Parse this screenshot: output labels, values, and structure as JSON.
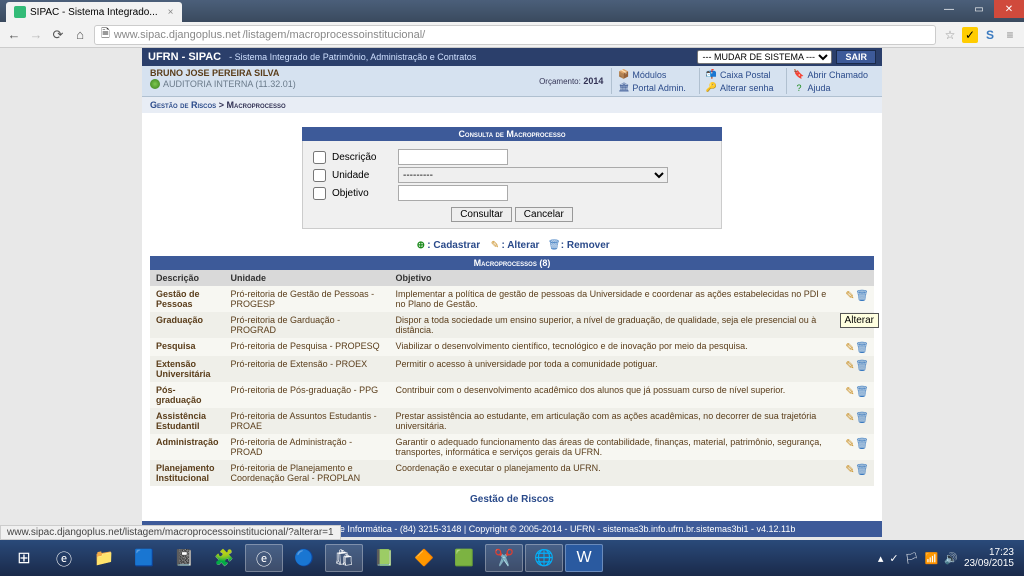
{
  "browser": {
    "tab_title": "SIPAC - Sistema Integrado...",
    "url_host": "www.sipac.djangoplus.net",
    "url_path": "/listagem/macroprocessoinstitucional/"
  },
  "header": {
    "app": "UFRN - SIPAC",
    "subtitle": "- Sistema Integrado de Patrimônio, Administração e Contratos",
    "system_select": "--- MUDAR DE SISTEMA ---",
    "logout": "SAIR"
  },
  "info": {
    "user": "BRUNO JOSE PEREIRA SILVA",
    "unit": "AUDITORIA INTERNA (11.32.01)",
    "orcamento_label": "Orçamento:",
    "orcamento_year": "2014",
    "links": {
      "modulos": "Módulos",
      "caixa": "Caixa Postal",
      "chamado": "Abrir Chamado",
      "portal": "Portal Admin.",
      "senha": "Alterar senha",
      "ajuda": "Ajuda"
    }
  },
  "breadcrumb": {
    "a": "Gestão de Riscos",
    "sep": ">",
    "b": "Macroprocesso"
  },
  "consult": {
    "title": "Consulta de Macroprocesso",
    "descricao": "Descrição",
    "unidade": "Unidade",
    "unidade_placeholder": "---------",
    "objetivo": "Objetivo",
    "btn_consultar": "Consultar",
    "btn_cancelar": "Cancelar"
  },
  "actions": {
    "cadastrar": ": Cadastrar",
    "alterar": ": Alterar",
    "remover": ": Remover"
  },
  "table": {
    "title": "Macroprocessos (8)",
    "h_desc": "Descrição",
    "h_unid": "Unidade",
    "h_obj": "Objetivo",
    "rows": [
      {
        "d": "Gestão de Pessoas",
        "u": "Pró-reitoria de Gestão de Pessoas - PROGESP",
        "o": "Implementar a política de gestão de pessoas da Universidade e coordenar as ações estabelecidas no PDI e no Plano de Gestão."
      },
      {
        "d": "Graduação",
        "u": "Pró-reitoria de Garduação - PROGRAD",
        "o": "Dispor a toda sociedade um ensino superior, a nível de graduação, de qualidade, seja ele presencial ou à distância."
      },
      {
        "d": "Pesquisa",
        "u": "Pró-reitoria de Pesquisa - PROPESQ",
        "o": "Viabilizar o desenvolvimento científico, tecnológico e de inovação por meio da pesquisa."
      },
      {
        "d": "Extensão Universitária",
        "u": "Pró-reitoria de Extensão - PROEX",
        "o": "Permitir o acesso à universidade por toda a comunidade potiguar."
      },
      {
        "d": "Pós-graduação",
        "u": "Pró-reitoria de Pós-graduação - PPG",
        "o": "Contribuir com o desenvolvimento acadêmico dos alunos que já possuam curso de nível superior."
      },
      {
        "d": "Assistência Estudantil",
        "u": "Pró-reitoria de Assuntos Estudantis - PROAE",
        "o": "Prestar assistência ao estudante, em articulação com as ações acadêmicas, no decorrer de sua trajetória universitária."
      },
      {
        "d": "Administração",
        "u": "Pró-reitoria de Administração - PROAD",
        "o": "Garantir o adequado funcionamento das áreas de contabilidade, finanças, material, patrimônio, segurança, transportes, informática e serviços gerais da UFRN."
      },
      {
        "d": "Planejamento Institucional",
        "u": "Pró-reitoria de Planejamento e Coordenação Geral - PROPLAN",
        "o": "Coordenação e executar o planejamento da UFRN."
      }
    ]
  },
  "tooltip": "Alterar",
  "backlink": "Gestão de Riscos",
  "footer": "SIPAC | Superintendência de Informática - (84) 3215-3148 | Copyright © 2005-2014 - UFRN - sistemas3b.info.ufrn.br.sistemas3bi1 - v4.12.11b",
  "status": "www.sipac.djangoplus.net/listagem/macroprocessoinstitucional/?alterar=1",
  "tray": {
    "time": "17:23",
    "date": "23/09/2015"
  }
}
